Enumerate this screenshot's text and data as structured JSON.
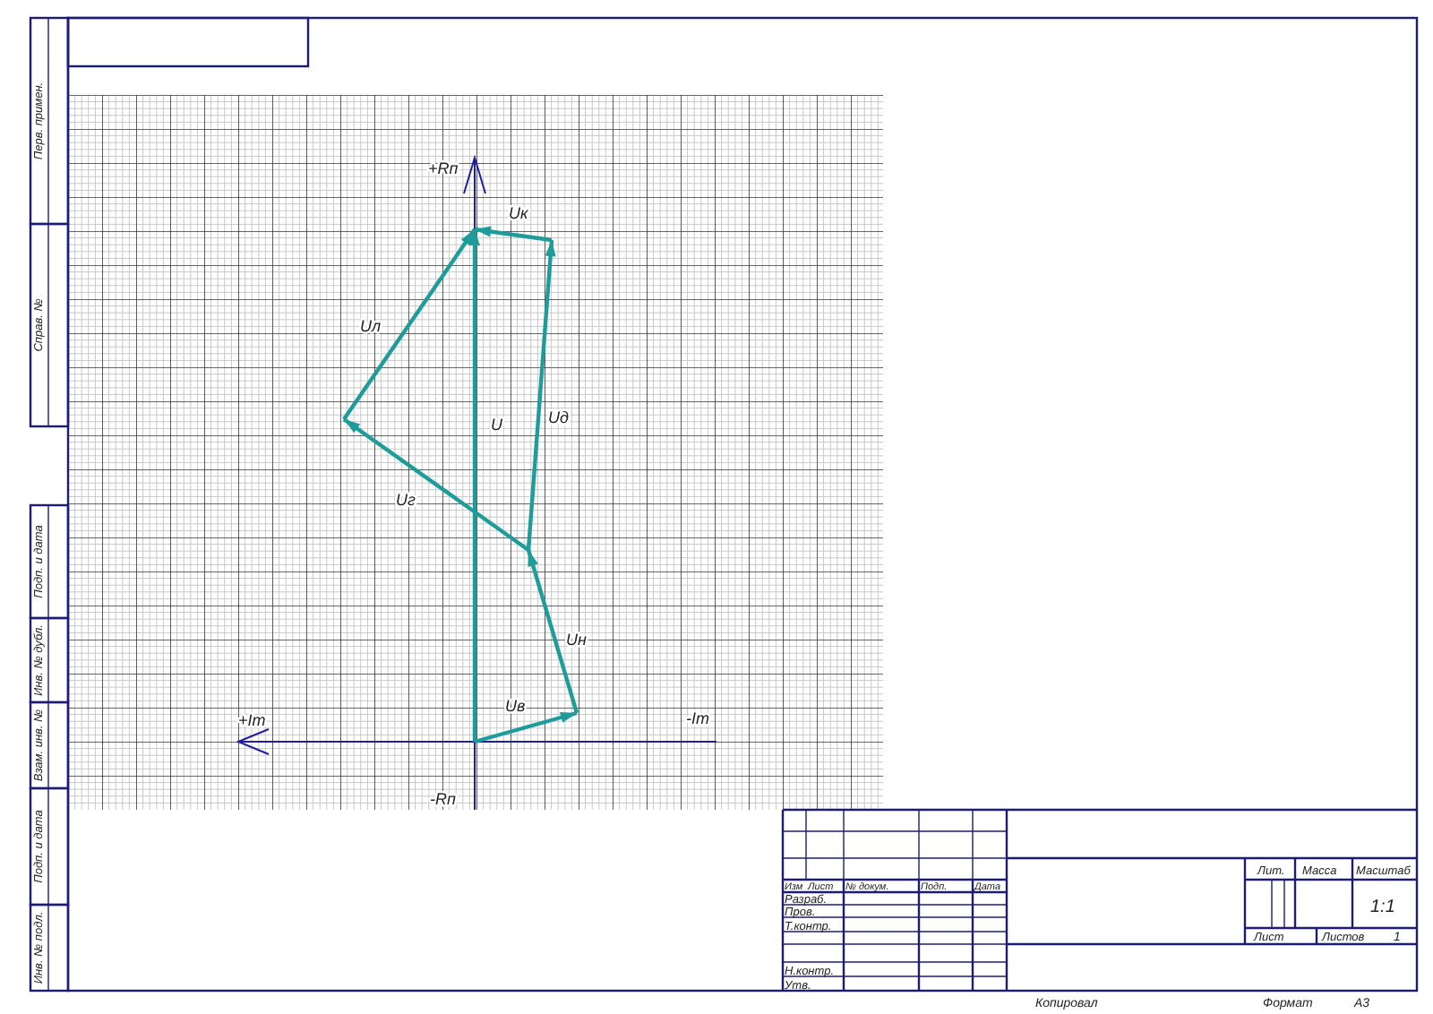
{
  "left_strip": {
    "top": [
      "Перв. примен.",
      "Справ. №"
    ],
    "bottom": [
      "Подп. и дата",
      "Инв. № дубл.",
      "Взам. инв. №",
      "Подп. и дата",
      "Инв. № подл."
    ]
  },
  "diagram": {
    "axes": {
      "up": "+Rп",
      "down": "-Rп",
      "left": "+Im",
      "right": "-Im"
    },
    "vectors": [
      {
        "label": "U"
      },
      {
        "label": "Uв"
      },
      {
        "label": "Uн"
      },
      {
        "label": "Uд"
      },
      {
        "label": "Uк"
      },
      {
        "label": "Uг"
      },
      {
        "label": "Uл"
      }
    ]
  },
  "title_block": {
    "columns": [
      "Изм",
      "Лист",
      "№ докум.",
      "Подп.",
      "Дата"
    ],
    "roles": [
      "Разраб.",
      "Пров.",
      "Т.контр.",
      "Н.контр.",
      "Утв."
    ],
    "headers": [
      "Лит.",
      "Масса",
      "Масштаб"
    ],
    "scale": "1:1",
    "sheet_label": "Лист",
    "sheets_label": "Листов",
    "sheets": "1"
  },
  "footer": {
    "copied": "Копировал",
    "format_label": "Формат",
    "format": "A3"
  }
}
